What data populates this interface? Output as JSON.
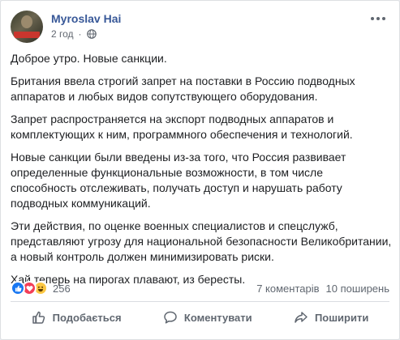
{
  "post": {
    "author": "Myroslav Hai",
    "time": "2 год",
    "separator": "·",
    "paragraphs": [
      "Доброе утро. Новые санкции.",
      "Британия ввела строгий запрет на поставки в Россию подводных аппаратов и любых видов сопутствующего оборудования.",
      "Запрет распространяется на экспорт подводных аппаратов и комплектующих к ним, программного обеспечения и технологий.",
      "Новые санкции были введены из-за того, что Россия развивает определенные функциональные возможности, в том числе способность отслеживать, получать доступ и нарушать работу подводных коммуникаций.",
      "Эти действия, по оценке военных специалистов и спецслужб, представляют угрозу для национальной безопасности Великобритании, а новый контроль должен минимизировать риски.",
      "Хай теперь на пирогах плавают, из бересты."
    ]
  },
  "stats": {
    "reactions_count": "256",
    "comments": "7 коментарів",
    "shares": "10 поширень"
  },
  "actions": {
    "like": "Подобається",
    "comment": "Коментувати",
    "share": "Поширити"
  },
  "colors": {
    "author_link": "#385898",
    "secondary_text": "#606770",
    "like_blue": "#1877f2",
    "love_red": "#f33e58",
    "haha_yellow": "#fcc844"
  },
  "icons": {
    "privacy": "globe-icon",
    "menu": "more-options-icon",
    "reactions": [
      "like-reaction-icon",
      "love-reaction-icon",
      "haha-reaction-icon"
    ],
    "action_like": "thumbs-up-icon",
    "action_comment": "comment-icon",
    "action_share": "share-icon"
  }
}
